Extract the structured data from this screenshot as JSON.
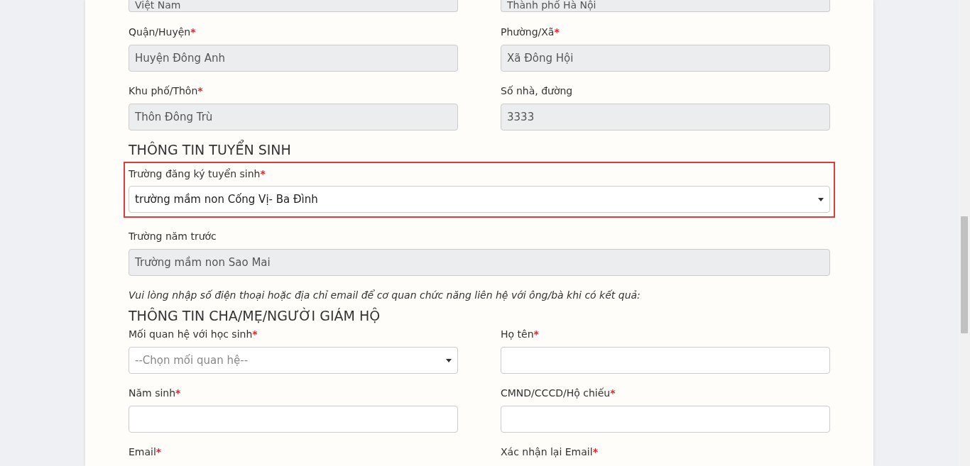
{
  "items": [
    {
      "kind": "pair",
      "cut": true,
      "fields": [
        {
          "kind": "text",
          "value": "Việt Nam",
          "disabled": true,
          "highlighted": false
        },
        {
          "kind": "text",
          "value": "Thành phố Hà Nội",
          "disabled": true,
          "highlighted": false
        }
      ]
    },
    {
      "kind": "pair",
      "fields": [
        {
          "kind": "text",
          "label": "Quận/Huyện",
          "required_mark": "*",
          "value": "Huyện Đông Anh",
          "disabled": true,
          "highlighted": false
        },
        {
          "kind": "text",
          "label": "Phường/Xã",
          "required_mark": "*",
          "value": "Xã Đông Hội",
          "disabled": true,
          "highlighted": false
        }
      ]
    },
    {
      "kind": "pair",
      "fields": [
        {
          "kind": "text",
          "label": "Khu phố/Thôn",
          "required_mark": "*",
          "value": "Thôn Đông Trù",
          "disabled": true,
          "highlighted": false
        },
        {
          "kind": "text",
          "label": "Số nhà, đường",
          "value": "3333",
          "disabled": true,
          "highlighted": false
        }
      ]
    },
    {
      "kind": "heading",
      "text": "THÔNG TIN TUYỂN SINH"
    },
    {
      "kind": "full",
      "fields": [
        {
          "kind": "select",
          "label": "Trường đăng ký tuyển sinh",
          "required_mark": "*",
          "value": "trường mầm non Cống Vị- Ba Đình",
          "disabled": false,
          "highlighted": true
        }
      ]
    },
    {
      "kind": "full",
      "fields": [
        {
          "kind": "text",
          "label": "Trường năm trước",
          "value": "Trường mầm non Sao Mai",
          "disabled": true,
          "highlighted": false
        }
      ]
    },
    {
      "kind": "note",
      "text": "Vui lòng nhập số điện thoại hoặc địa chỉ email để cơ quan chức năng liên hệ với ông/bà khi có kết quả:"
    },
    {
      "kind": "heading",
      "text": "THÔNG TIN CHA/MẸ/NGƯỜI GIÁM HỘ"
    },
    {
      "kind": "pair",
      "fields": [
        {
          "kind": "select",
          "label": "Mối quan hệ với học sinh",
          "required_mark": "*",
          "placeholder": "--Chọn mối quan hệ--",
          "disabled": false,
          "highlighted": false
        },
        {
          "kind": "text",
          "label": "Họ tên",
          "required_mark": "*",
          "disabled": false,
          "highlighted": false
        }
      ]
    },
    {
      "kind": "pair",
      "fields": [
        {
          "kind": "text",
          "label": "Năm sinh",
          "required_mark": "*",
          "disabled": false,
          "highlighted": false
        },
        {
          "kind": "text",
          "label": "CMND/CCCD/Hộ chiếu",
          "required_mark": "*",
          "disabled": false,
          "highlighted": false
        }
      ]
    },
    {
      "kind": "pair",
      "labels_only": true,
      "fields": [
        {
          "kind": "text",
          "label": "Email",
          "required_mark": "*",
          "highlighted": false
        },
        {
          "kind": "text",
          "label": "Xác nhận lại Email",
          "required_mark": "*",
          "highlighted": false
        }
      ]
    }
  ]
}
